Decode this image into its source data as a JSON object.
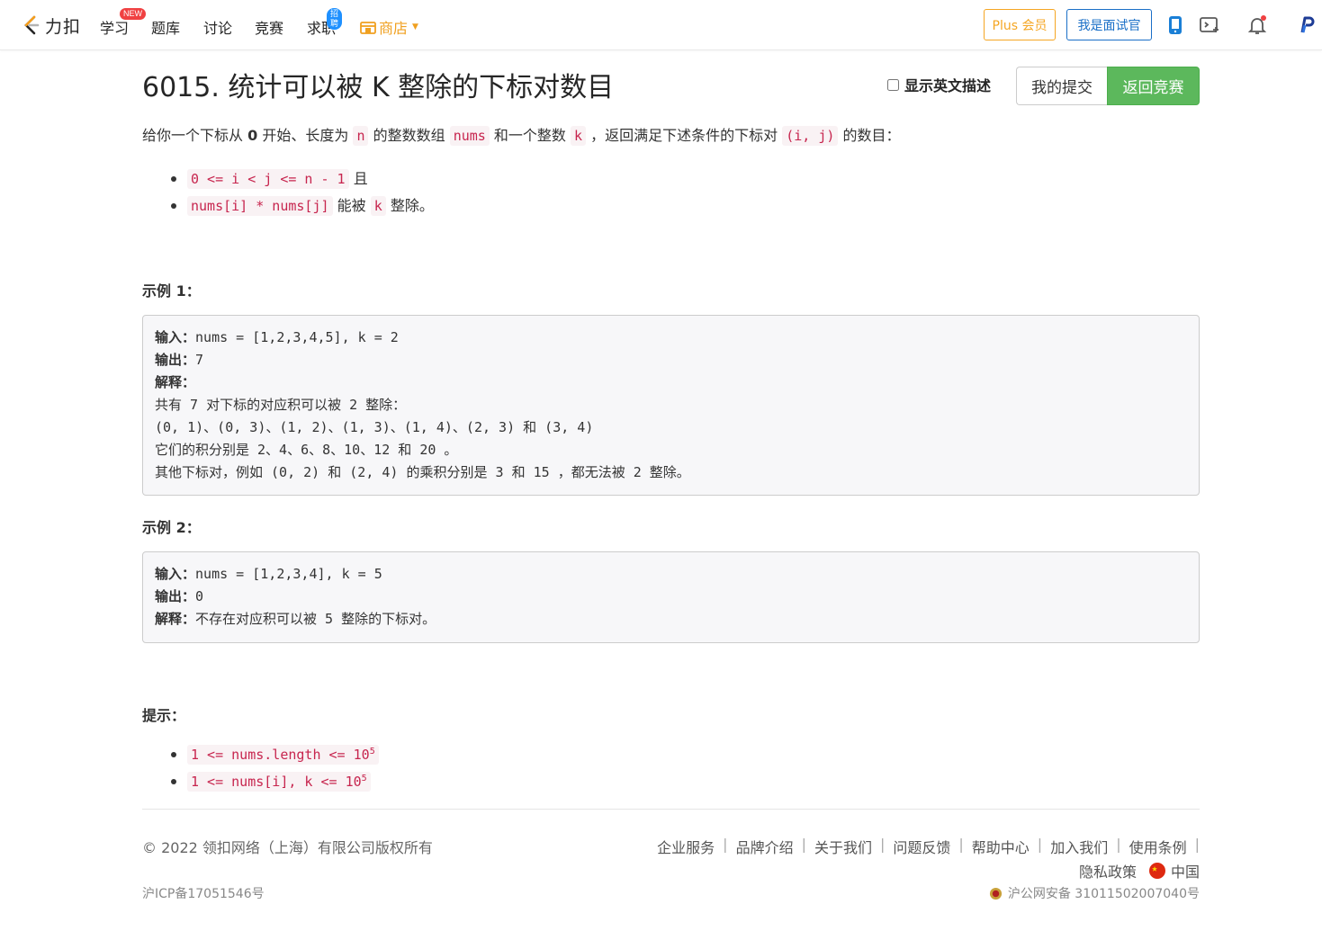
{
  "nav": {
    "logo_text": "力扣",
    "items": [
      {
        "label": "学习",
        "badge": "NEW"
      },
      {
        "label": "题库"
      },
      {
        "label": "讨论"
      },
      {
        "label": "竞赛"
      },
      {
        "label": "求职",
        "badge": "招聘"
      }
    ],
    "shop_label": "商店",
    "plus_label": "Plus 会员",
    "interviewer_label": "我是面试官",
    "colors": {
      "accent_orange": "#f5a623",
      "accent_blue": "#1a6fc7",
      "badge_red": "#f04142",
      "badge_blue": "#1e90ff"
    }
  },
  "header": {
    "title": "6015. 统计可以被 K 整除的下标对数目",
    "show_english_label": "显示英文描述",
    "my_submissions_label": "我的提交",
    "back_label": "返回竞赛"
  },
  "description": {
    "p1": "给你一个下标从",
    "p_zero": "0",
    "p2": "开始、长度为",
    "n": "n",
    "p3": "的整数数组",
    "nums": "nums",
    "p4": "和一个整数",
    "k": "k",
    "p5": "，返回满足下述条件的下标对",
    "ij": "(i, j)",
    "p6": "的数目：",
    "conditions": [
      {
        "code": "0 <= i < j <= n - 1",
        "text": "且"
      },
      {
        "code": "nums[i] * nums[j]",
        "text": "能被",
        "code2": "k",
        "text2": "整除。"
      }
    ]
  },
  "examples": [
    {
      "heading": "示例 1：",
      "input_label": "输入：",
      "input": "nums = [1,2,3,4,5], k = 2",
      "output_label": "输出：",
      "output": "7",
      "explain_label": "解释：",
      "explain_lines": [
        "共有 7 对下标的对应积可以被 2 整除：",
        "(0, 1)、(0, 3)、(1, 2)、(1, 3)、(1, 4)、(2, 3) 和 (3, 4)",
        "它们的积分别是 2、4、6、8、10、12 和 20 。",
        "其他下标对，例如 (0, 2) 和 (2, 4) 的乘积分别是 3 和 15 ，都无法被 2 整除。"
      ]
    },
    {
      "heading": "示例 2：",
      "input_label": "输入：",
      "input": "nums = [1,2,3,4], k = 5",
      "output_label": "输出：",
      "output": "0",
      "explain_label": "解释：",
      "explain_inline": "不存在对应积可以被 5 整除的下标对。"
    }
  ],
  "hints": {
    "heading": "提示：",
    "items": [
      {
        "code": "1 <= nums.length <= 10",
        "sup": "5"
      },
      {
        "code": "1 <= nums[i], k <= 10",
        "sup": "5"
      }
    ]
  },
  "footer": {
    "copyright": "© 2022 领扣网络（上海）有限公司版权所有",
    "links": [
      "企业服务",
      "品牌介绍",
      "关于我们",
      "问题反馈",
      "帮助中心",
      "加入我们",
      "使用条例"
    ],
    "privacy": "隐私政策",
    "region": "中国",
    "icp": "沪ICP备17051546号",
    "gongan": "沪公网安备 31011502007040号"
  }
}
